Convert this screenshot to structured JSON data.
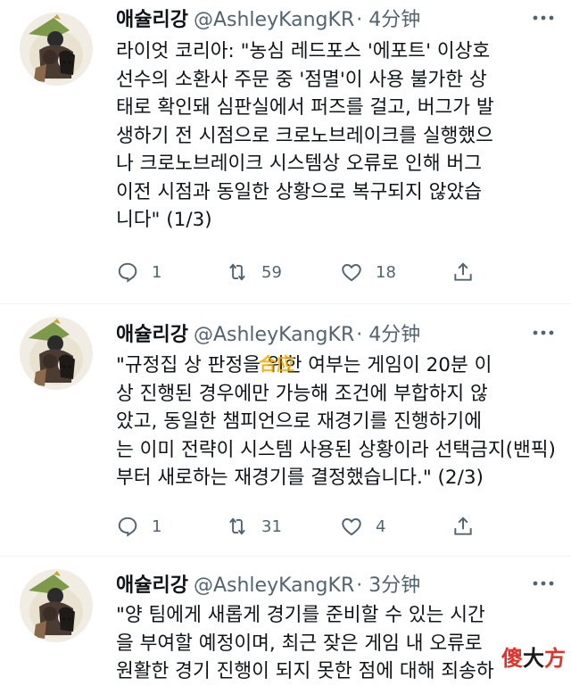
{
  "tweets": [
    {
      "name": "애슐리강",
      "handle": "@AshleyKangKR",
      "time": "· 4分钟",
      "text": "라이엇 코리아: \"농심 레드포스 '에포트' 이상호\n선수의 소환사 주문 중 '점멸'이 사용 불가한 상\n태로 확인돼 심판실에서 퍼즈를 걸고, 버그가 발\n생하기 전 시점으로 크로노브레이크를 실행했으\n나 크로노브레이크 시스템상 오류로 인해 버그\n이전 시점과 동일한 상황으로 복구되지 않았습\n니다\" (1/3)",
      "replies": "1",
      "retweets": "59",
      "likes": "18"
    },
    {
      "name": "애슐리강",
      "handle": "@AshleyKangKR",
      "time": "· 4分钟",
      "text": "\"규정집 상 판정을 위한 여부는 게임이 20분 이\n상 진행된 경우에만 가능해 조건에 부합하지 않\n았고, 동일한 챔피언으로 재경기를 진행하기에\n는 이미 전략이 시스템 사용된 상황이라 선택금지(밴픽)\n부터 새로하는 재경기를 결정했습니다.\" (2/3)",
      "replies": "1",
      "retweets": "31",
      "likes": "4"
    },
    {
      "name": "애슐리강",
      "handle": "@AshleyKangKR",
      "time": "· 3分钟",
      "text": "\"양 팀에게 새롭게 경기를 준비할 수 있는 시간\n을 부여할 예정이며, 최근 잦은 게임 내 오류로\n원활한 경기 진행이 되지 못한 점에 대해 죄송하"
    }
  ],
  "overlay": "合应",
  "watermark": [
    "傻",
    "大",
    "方"
  ],
  "icons": [
    "reply-icon",
    "retweet-icon",
    "like-icon",
    "share-icon",
    "more-icon",
    "avatar"
  ]
}
